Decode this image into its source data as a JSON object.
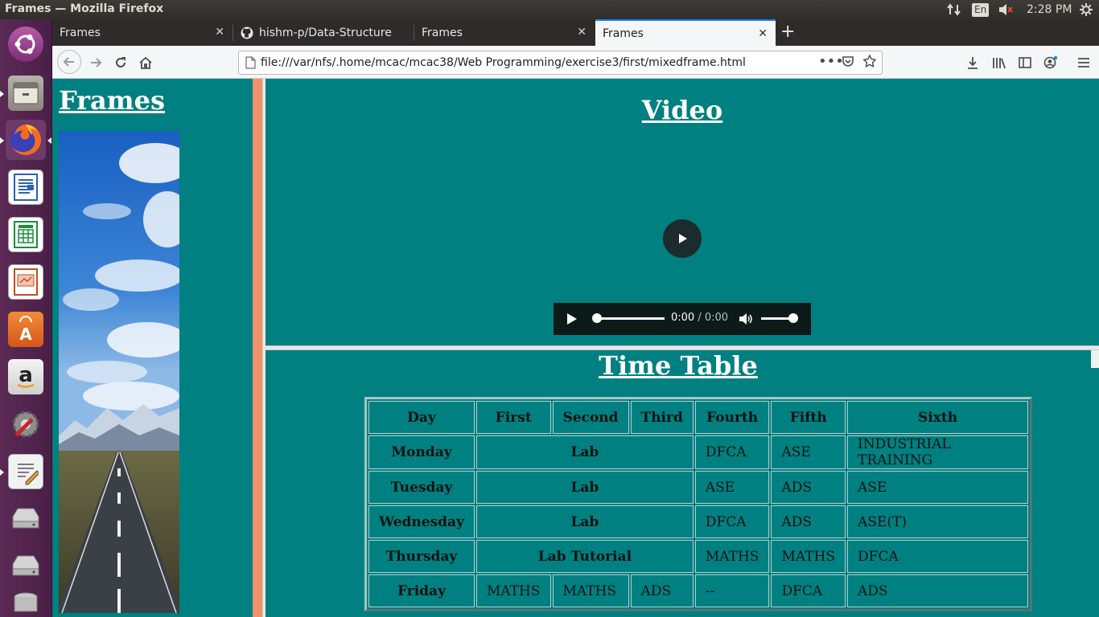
{
  "window_title": "Frames — Mozilla Firefox",
  "system": {
    "lang": "En",
    "clock": "2:28 PM"
  },
  "tabs": [
    {
      "label": "Frames"
    },
    {
      "label": "hishm-p/Data-Structures"
    },
    {
      "label": "Frames"
    },
    {
      "label": "Frames"
    }
  ],
  "url": "file:///var/nfs/.home/mcac/mcac38/Web Programming/exercise3/first/mixedframe.html",
  "left_frame": {
    "heading": "Frames"
  },
  "video_frame": {
    "heading": "Video",
    "time_current": "0:00",
    "time_sep": " / ",
    "time_total": "0:00"
  },
  "timetable": {
    "heading": "Time Table",
    "headers": [
      "Day",
      "First",
      "Second",
      "Third",
      "Fourth",
      "Fifth",
      "Sixth"
    ],
    "rows": [
      {
        "day": "Monday",
        "lab": "Lab",
        "c4": "DFCA",
        "c5": "ASE",
        "c6": "INDUSTRIAL TRAINING"
      },
      {
        "day": "Tuesday",
        "lab": "Lab",
        "c4": "ASE",
        "c5": "ADS",
        "c6": "ASE"
      },
      {
        "day": "Wednesday",
        "lab": "Lab",
        "c4": "DFCA",
        "c5": "ADS",
        "c6": "ASE(T)"
      },
      {
        "day": "Thursday",
        "lab": "Lab Tutorial",
        "c4": "MATHS",
        "c5": "MATHS",
        "c6": "DFCA"
      },
      {
        "day": "Friday",
        "c1": "MATHS",
        "c2": "MATHS",
        "c3": "ADS",
        "c4": "--",
        "c5": "DFCA",
        "c6": "ADS"
      }
    ]
  },
  "colors": {
    "frame_bg": "#008080",
    "frame_border": "#f0926a",
    "launcher": "#5a2a55"
  }
}
